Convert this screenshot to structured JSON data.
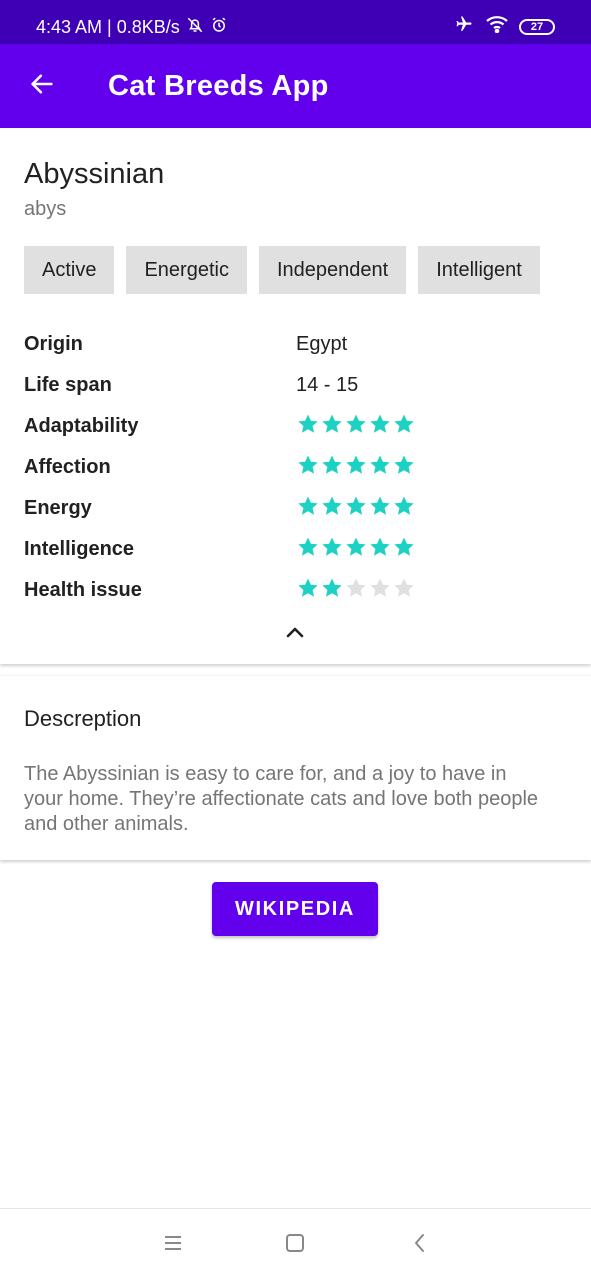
{
  "status_bar": {
    "time_speed": "4:43 AM | 0.8KB/s",
    "battery": "27",
    "icons": [
      "silent-icon",
      "alarm-icon",
      "airplane-icon",
      "wifi-icon",
      "battery-icon"
    ]
  },
  "app_bar": {
    "title": "Cat Breeds App",
    "back_icon": "arrow-back-icon"
  },
  "breed": {
    "name": "Abyssinian",
    "id": "abys",
    "temperament": [
      "Active",
      "Energetic",
      "Independent",
      "Intelligent"
    ]
  },
  "attributes": {
    "origin": {
      "label": "Origin",
      "value": "Egypt"
    },
    "life_span": {
      "label": "Life span",
      "value": "14 - 15"
    },
    "adaptability": {
      "label": "Adaptability",
      "rating": 5,
      "max": 5
    },
    "affection": {
      "label": "Affection",
      "rating": 5,
      "max": 5
    },
    "energy": {
      "label": "Energy",
      "rating": 5,
      "max": 5
    },
    "intelligence": {
      "label": "Intelligence",
      "rating": 5,
      "max": 5
    },
    "health_issue": {
      "label": "Health issue",
      "rating": 2,
      "max": 5
    }
  },
  "description": {
    "title": "Descreption",
    "text": "The Abyssinian is easy to care for, and a joy to have in your home. They’re affectionate cats and love both people and other animals."
  },
  "wiki_button": {
    "label": "WIKIPEDIA"
  },
  "colors": {
    "primary": "#6200ee",
    "primary_dark": "#3f00b5",
    "star_filled": "#1dd2c4",
    "star_empty": "#e0e0e0"
  }
}
